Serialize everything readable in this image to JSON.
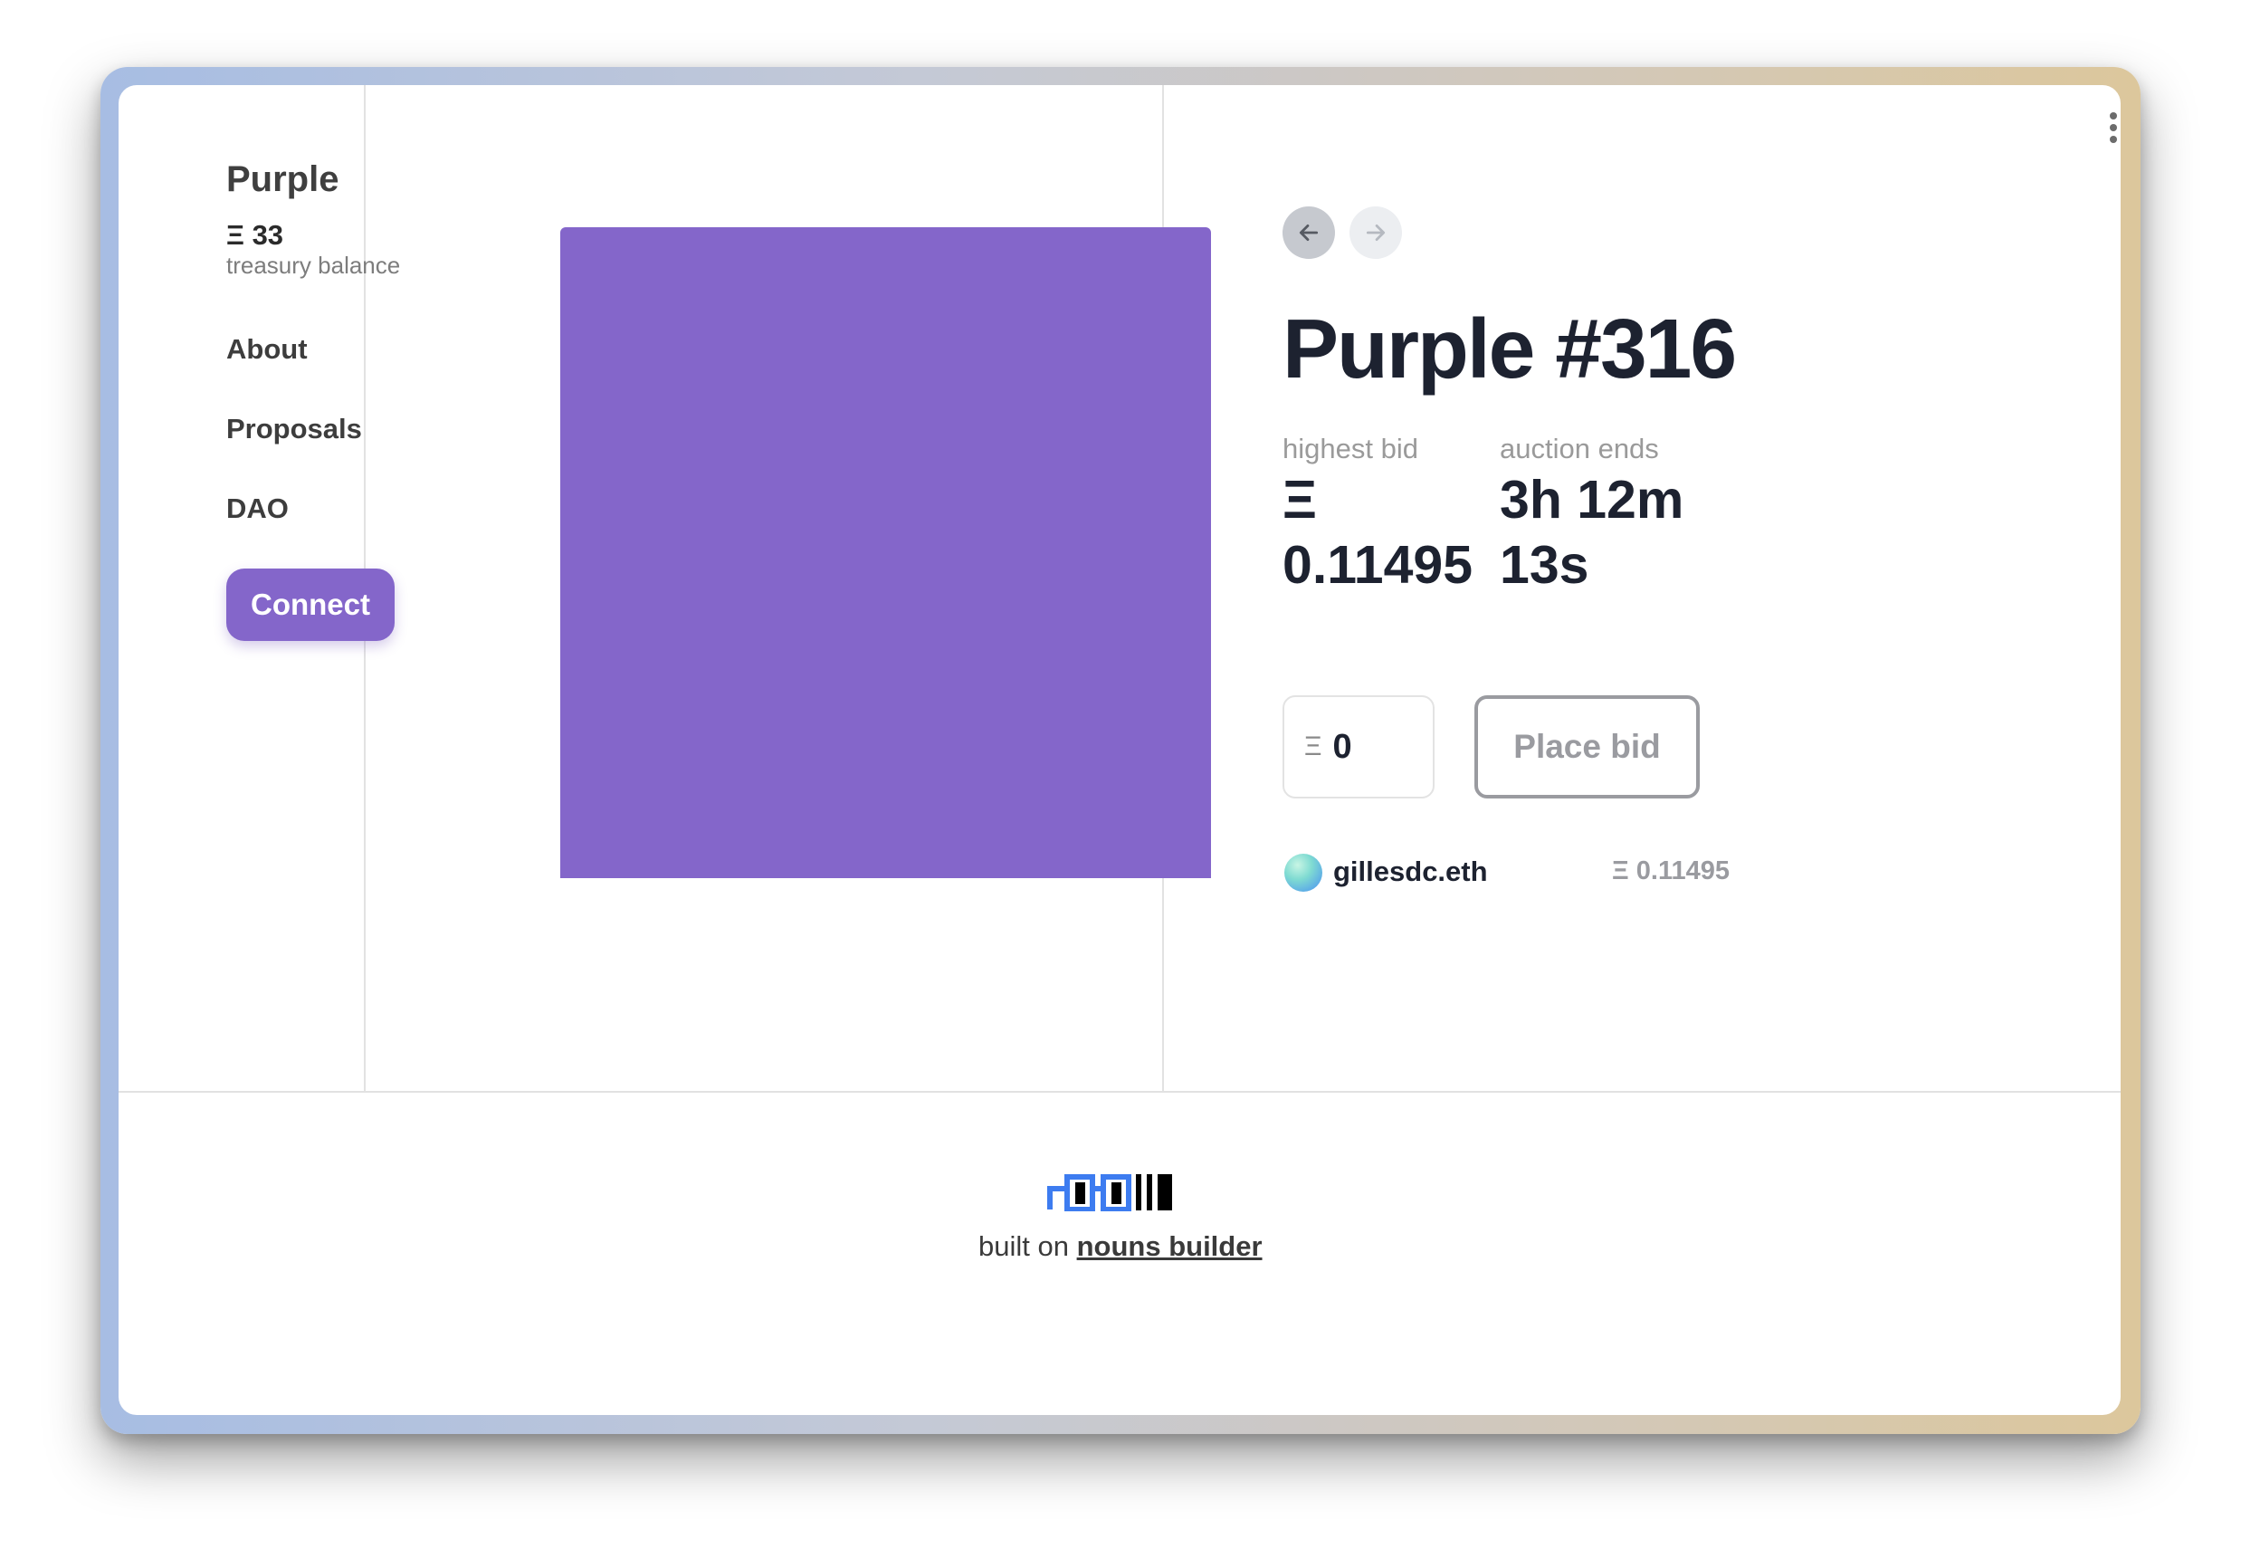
{
  "sidebar": {
    "dao_name": "Purple",
    "treasury_value": "Ξ 33",
    "treasury_label": "treasury balance",
    "nav": [
      {
        "label": "About"
      },
      {
        "label": "Proposals"
      },
      {
        "label": "DAO"
      }
    ],
    "connect_label": "Connect"
  },
  "auction": {
    "prev_icon": "arrow-left-icon",
    "next_icon": "arrow-right-icon",
    "title": "Purple #316",
    "highest_bid_label": "highest bid",
    "highest_bid_value": "Ξ 0.11495",
    "auction_ends_label": "auction ends",
    "auction_ends_value": "3h 12m 13s",
    "bid_input_currency": "Ξ",
    "bid_input_value": "0",
    "place_bid_label": "Place bid",
    "latest_bid": {
      "bidder": "gillesdc.eth",
      "amount": "Ξ 0.11495"
    },
    "artwork_color": "#8466ca"
  },
  "footer": {
    "built_on_text": "built on",
    "link_text": "nouns builder"
  },
  "colors": {
    "accent": "#8466ca",
    "text_dark": "#1d2230",
    "muted": "#9a9ba0"
  }
}
